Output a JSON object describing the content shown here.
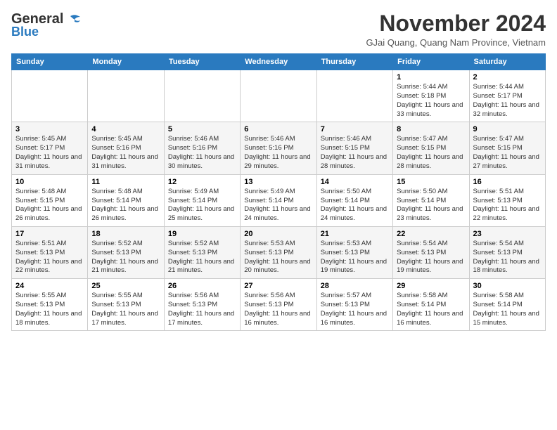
{
  "header": {
    "logo_line1": "General",
    "logo_line2": "Blue",
    "month": "November 2024",
    "location": "GJai Quang, Quang Nam Province, Vietnam"
  },
  "weekdays": [
    "Sunday",
    "Monday",
    "Tuesday",
    "Wednesday",
    "Thursday",
    "Friday",
    "Saturday"
  ],
  "weeks": [
    [
      {
        "day": "",
        "info": ""
      },
      {
        "day": "",
        "info": ""
      },
      {
        "day": "",
        "info": ""
      },
      {
        "day": "",
        "info": ""
      },
      {
        "day": "",
        "info": ""
      },
      {
        "day": "1",
        "info": "Sunrise: 5:44 AM\nSunset: 5:18 PM\nDaylight: 11 hours\nand 33 minutes."
      },
      {
        "day": "2",
        "info": "Sunrise: 5:44 AM\nSunset: 5:17 PM\nDaylight: 11 hours\nand 32 minutes."
      }
    ],
    [
      {
        "day": "3",
        "info": "Sunrise: 5:45 AM\nSunset: 5:17 PM\nDaylight: 11 hours\nand 31 minutes."
      },
      {
        "day": "4",
        "info": "Sunrise: 5:45 AM\nSunset: 5:16 PM\nDaylight: 11 hours\nand 31 minutes."
      },
      {
        "day": "5",
        "info": "Sunrise: 5:46 AM\nSunset: 5:16 PM\nDaylight: 11 hours\nand 30 minutes."
      },
      {
        "day": "6",
        "info": "Sunrise: 5:46 AM\nSunset: 5:16 PM\nDaylight: 11 hours\nand 29 minutes."
      },
      {
        "day": "7",
        "info": "Sunrise: 5:46 AM\nSunset: 5:15 PM\nDaylight: 11 hours\nand 28 minutes."
      },
      {
        "day": "8",
        "info": "Sunrise: 5:47 AM\nSunset: 5:15 PM\nDaylight: 11 hours\nand 28 minutes."
      },
      {
        "day": "9",
        "info": "Sunrise: 5:47 AM\nSunset: 5:15 PM\nDaylight: 11 hours\nand 27 minutes."
      }
    ],
    [
      {
        "day": "10",
        "info": "Sunrise: 5:48 AM\nSunset: 5:15 PM\nDaylight: 11 hours\nand 26 minutes."
      },
      {
        "day": "11",
        "info": "Sunrise: 5:48 AM\nSunset: 5:14 PM\nDaylight: 11 hours\nand 26 minutes."
      },
      {
        "day": "12",
        "info": "Sunrise: 5:49 AM\nSunset: 5:14 PM\nDaylight: 11 hours\nand 25 minutes."
      },
      {
        "day": "13",
        "info": "Sunrise: 5:49 AM\nSunset: 5:14 PM\nDaylight: 11 hours\nand 24 minutes."
      },
      {
        "day": "14",
        "info": "Sunrise: 5:50 AM\nSunset: 5:14 PM\nDaylight: 11 hours\nand 24 minutes."
      },
      {
        "day": "15",
        "info": "Sunrise: 5:50 AM\nSunset: 5:14 PM\nDaylight: 11 hours\nand 23 minutes."
      },
      {
        "day": "16",
        "info": "Sunrise: 5:51 AM\nSunset: 5:13 PM\nDaylight: 11 hours\nand 22 minutes."
      }
    ],
    [
      {
        "day": "17",
        "info": "Sunrise: 5:51 AM\nSunset: 5:13 PM\nDaylight: 11 hours\nand 22 minutes."
      },
      {
        "day": "18",
        "info": "Sunrise: 5:52 AM\nSunset: 5:13 PM\nDaylight: 11 hours\nand 21 minutes."
      },
      {
        "day": "19",
        "info": "Sunrise: 5:52 AM\nSunset: 5:13 PM\nDaylight: 11 hours\nand 21 minutes."
      },
      {
        "day": "20",
        "info": "Sunrise: 5:53 AM\nSunset: 5:13 PM\nDaylight: 11 hours\nand 20 minutes."
      },
      {
        "day": "21",
        "info": "Sunrise: 5:53 AM\nSunset: 5:13 PM\nDaylight: 11 hours\nand 19 minutes."
      },
      {
        "day": "22",
        "info": "Sunrise: 5:54 AM\nSunset: 5:13 PM\nDaylight: 11 hours\nand 19 minutes."
      },
      {
        "day": "23",
        "info": "Sunrise: 5:54 AM\nSunset: 5:13 PM\nDaylight: 11 hours\nand 18 minutes."
      }
    ],
    [
      {
        "day": "24",
        "info": "Sunrise: 5:55 AM\nSunset: 5:13 PM\nDaylight: 11 hours\nand 18 minutes."
      },
      {
        "day": "25",
        "info": "Sunrise: 5:55 AM\nSunset: 5:13 PM\nDaylight: 11 hours\nand 17 minutes."
      },
      {
        "day": "26",
        "info": "Sunrise: 5:56 AM\nSunset: 5:13 PM\nDaylight: 11 hours\nand 17 minutes."
      },
      {
        "day": "27",
        "info": "Sunrise: 5:56 AM\nSunset: 5:13 PM\nDaylight: 11 hours\nand 16 minutes."
      },
      {
        "day": "28",
        "info": "Sunrise: 5:57 AM\nSunset: 5:13 PM\nDaylight: 11 hours\nand 16 minutes."
      },
      {
        "day": "29",
        "info": "Sunrise: 5:58 AM\nSunset: 5:14 PM\nDaylight: 11 hours\nand 16 minutes."
      },
      {
        "day": "30",
        "info": "Sunrise: 5:58 AM\nSunset: 5:14 PM\nDaylight: 11 hours\nand 15 minutes."
      }
    ]
  ]
}
